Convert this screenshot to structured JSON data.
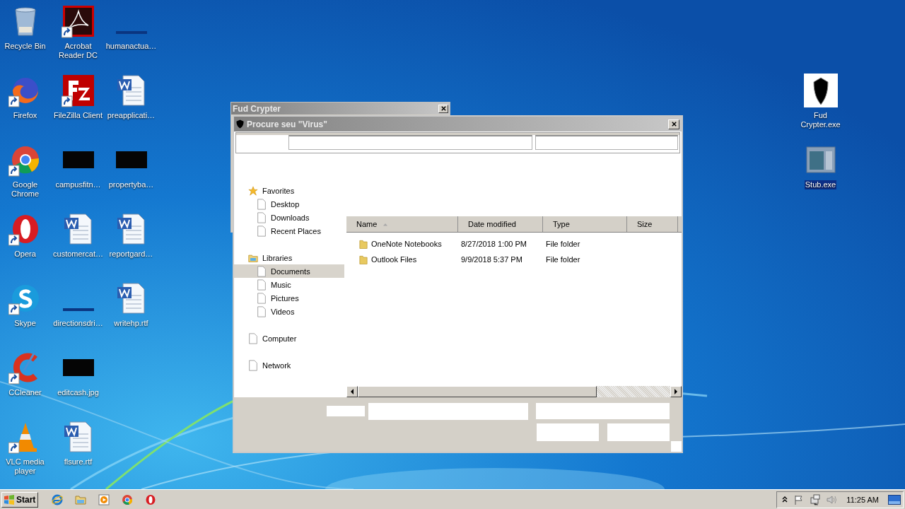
{
  "desktop_icons": [
    {
      "label": "Recycle Bin",
      "kind": "trash",
      "shortcut": false,
      "selected": false
    },
    {
      "label": "Firefox",
      "kind": "fox",
      "shortcut": true,
      "selected": false
    },
    {
      "label": "Google\nChrome",
      "kind": "chrome",
      "shortcut": true,
      "selected": false
    },
    {
      "label": "Opera",
      "kind": "opera",
      "shortcut": true,
      "selected": false
    },
    {
      "label": "Skype",
      "kind": "skype",
      "shortcut": true,
      "selected": false
    },
    {
      "label": "CCleaner",
      "kind": "cleaner",
      "shortcut": true,
      "selected": false
    },
    {
      "label": "VLC media\nplayer",
      "kind": "cone",
      "shortcut": true,
      "selected": false
    },
    {
      "label": "Acrobat\nReader DC",
      "kind": "pdf",
      "shortcut": true,
      "selected": false
    },
    {
      "label": "FileZilla Client",
      "kind": "ftp",
      "shortcut": true,
      "selected": false
    },
    {
      "label": "campusfitn…",
      "kind": "dark",
      "shortcut": false,
      "selected": false
    },
    {
      "label": "customercat…",
      "kind": "word",
      "shortcut": false,
      "selected": false
    },
    {
      "label": "directionsdri…",
      "kind": "blank",
      "shortcut": false,
      "selected": false
    },
    {
      "label": "editcash.jpg",
      "kind": "dark",
      "shortcut": false,
      "selected": false
    },
    {
      "label": "flsure.rtf",
      "kind": "word",
      "shortcut": false,
      "selected": false
    },
    {
      "label": "humanactua…",
      "kind": "blank",
      "shortcut": false,
      "selected": false
    },
    {
      "label": "preapplicati…",
      "kind": "word",
      "shortcut": false,
      "selected": false
    },
    {
      "label": "propertyba…",
      "kind": "dark",
      "shortcut": false,
      "selected": false
    },
    {
      "label": "reportgard…",
      "kind": "word",
      "shortcut": false,
      "selected": false
    },
    {
      "label": "writehp.rtf",
      "kind": "word",
      "shortcut": false,
      "selected": false
    }
  ],
  "right_icons": [
    {
      "label": "Fud\nCrypter.exe",
      "kind": "shield",
      "shortcut": false,
      "selected": false
    },
    {
      "label": "Stub.exe",
      "kind": "stub",
      "shortcut": false,
      "selected": true
    }
  ],
  "back_window": {
    "title": "Fud Crypter"
  },
  "dialog": {
    "title": "Procure seu \"Virus\"",
    "nav": [
      {
        "label": "Favorites",
        "kind": "star",
        "selected": false,
        "children": [
          {
            "label": "Desktop",
            "selected": false
          },
          {
            "label": "Downloads",
            "selected": false
          },
          {
            "label": "Recent Places",
            "selected": false
          }
        ]
      },
      {
        "label": "Libraries",
        "kind": "library",
        "selected": false,
        "children": [
          {
            "label": "Documents",
            "selected": true
          },
          {
            "label": "Music",
            "selected": false
          },
          {
            "label": "Pictures",
            "selected": false
          },
          {
            "label": "Videos",
            "selected": false
          }
        ]
      },
      {
        "label": "Computer",
        "kind": "page",
        "selected": false
      },
      {
        "label": "Network",
        "kind": "page",
        "selected": false
      }
    ],
    "columns": [
      {
        "label": "Name",
        "sorted": true
      },
      {
        "label": "Date modified",
        "sorted": false
      },
      {
        "label": "Type",
        "sorted": false
      },
      {
        "label": "Size",
        "sorted": false
      }
    ],
    "rows": [
      {
        "name": "OneNote Notebooks",
        "date": "8/27/2018 1:00 PM",
        "type": "File folder"
      },
      {
        "name": "Outlook Files",
        "date": "9/9/2018 5:37 PM",
        "type": "File folder"
      }
    ]
  },
  "taskbar": {
    "start": "Start",
    "quick_launch": [
      {
        "kind": "ie"
      },
      {
        "kind": "folder"
      },
      {
        "kind": "media"
      },
      {
        "kind": "chrome"
      },
      {
        "kind": "opera"
      }
    ],
    "time": "11:25 AM"
  }
}
